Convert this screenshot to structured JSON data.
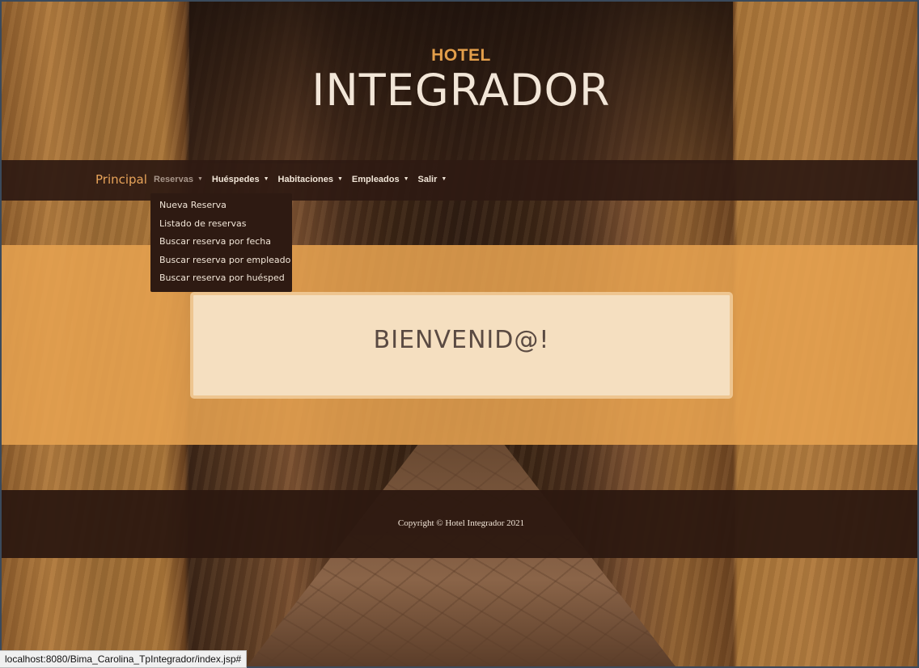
{
  "brand": {
    "small": "HOTEL",
    "big": "INTEGRADOR"
  },
  "nav": {
    "home": "Principal",
    "items": [
      {
        "label": "Reservas",
        "active": true
      },
      {
        "label": "Huéspedes"
      },
      {
        "label": "Habitaciones"
      },
      {
        "label": "Empleados"
      },
      {
        "label": "Salir"
      }
    ]
  },
  "dropdown": {
    "items": [
      "Nueva Reserva",
      "Listado de reservas",
      "Buscar reserva por fecha",
      "Buscar reserva por empleado",
      "Buscar reserva por huésped"
    ]
  },
  "welcome": {
    "title": "BIENVENID@!"
  },
  "footer": {
    "copyright": "Copyright © Hotel Integrador 2021"
  },
  "status_bar": {
    "url": "localhost:8080/Bima_Carolina_TpIntegrador/index.jsp#"
  },
  "colors": {
    "accent": "#e39e4a",
    "navbar": "#2e1a12",
    "band": "#e6a250",
    "card": "#f5dfc0"
  }
}
